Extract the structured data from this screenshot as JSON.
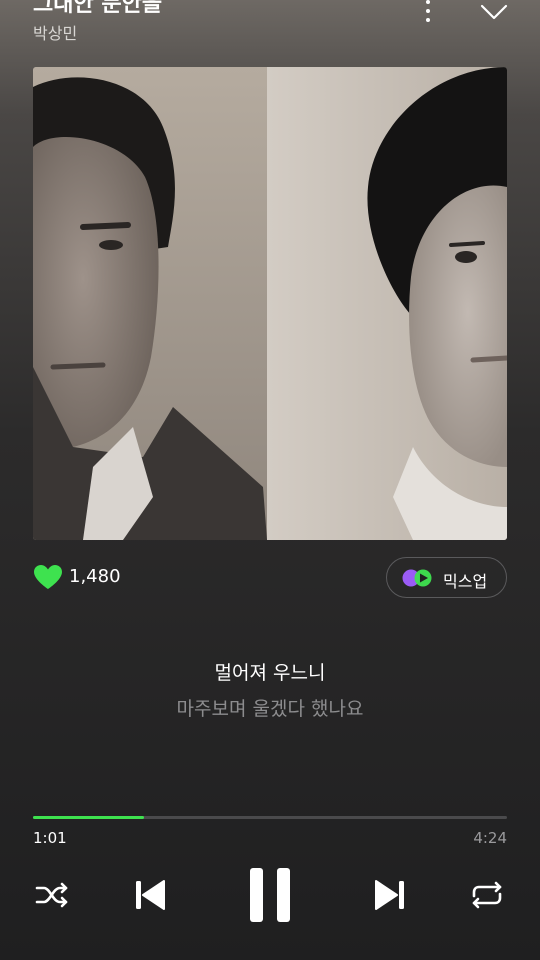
{
  "header": {
    "song_title": "그대안 문안을",
    "artist": "박상민"
  },
  "icons": {
    "more": "more-vertical-icon",
    "collapse": "chevron-down-icon",
    "like": "heart-icon",
    "mixup": "mixup-icon",
    "shuffle": "shuffle-icon",
    "previous": "skip-previous-icon",
    "pause": "pause-icon",
    "next": "skip-next-icon",
    "repeat": "repeat-icon"
  },
  "likes": {
    "count": "1,480"
  },
  "mixup": {
    "label": "믹스업"
  },
  "lyrics": {
    "current": "멀어져 우느니",
    "next": "마주보며 울겠다 했나요"
  },
  "playback": {
    "elapsed": "1:01",
    "total": "4:24",
    "progress_fraction": 0.235
  },
  "colors": {
    "accent": "#3ee24f",
    "heart": "#3ee24f",
    "secondary_text": "#8c8c8e"
  }
}
